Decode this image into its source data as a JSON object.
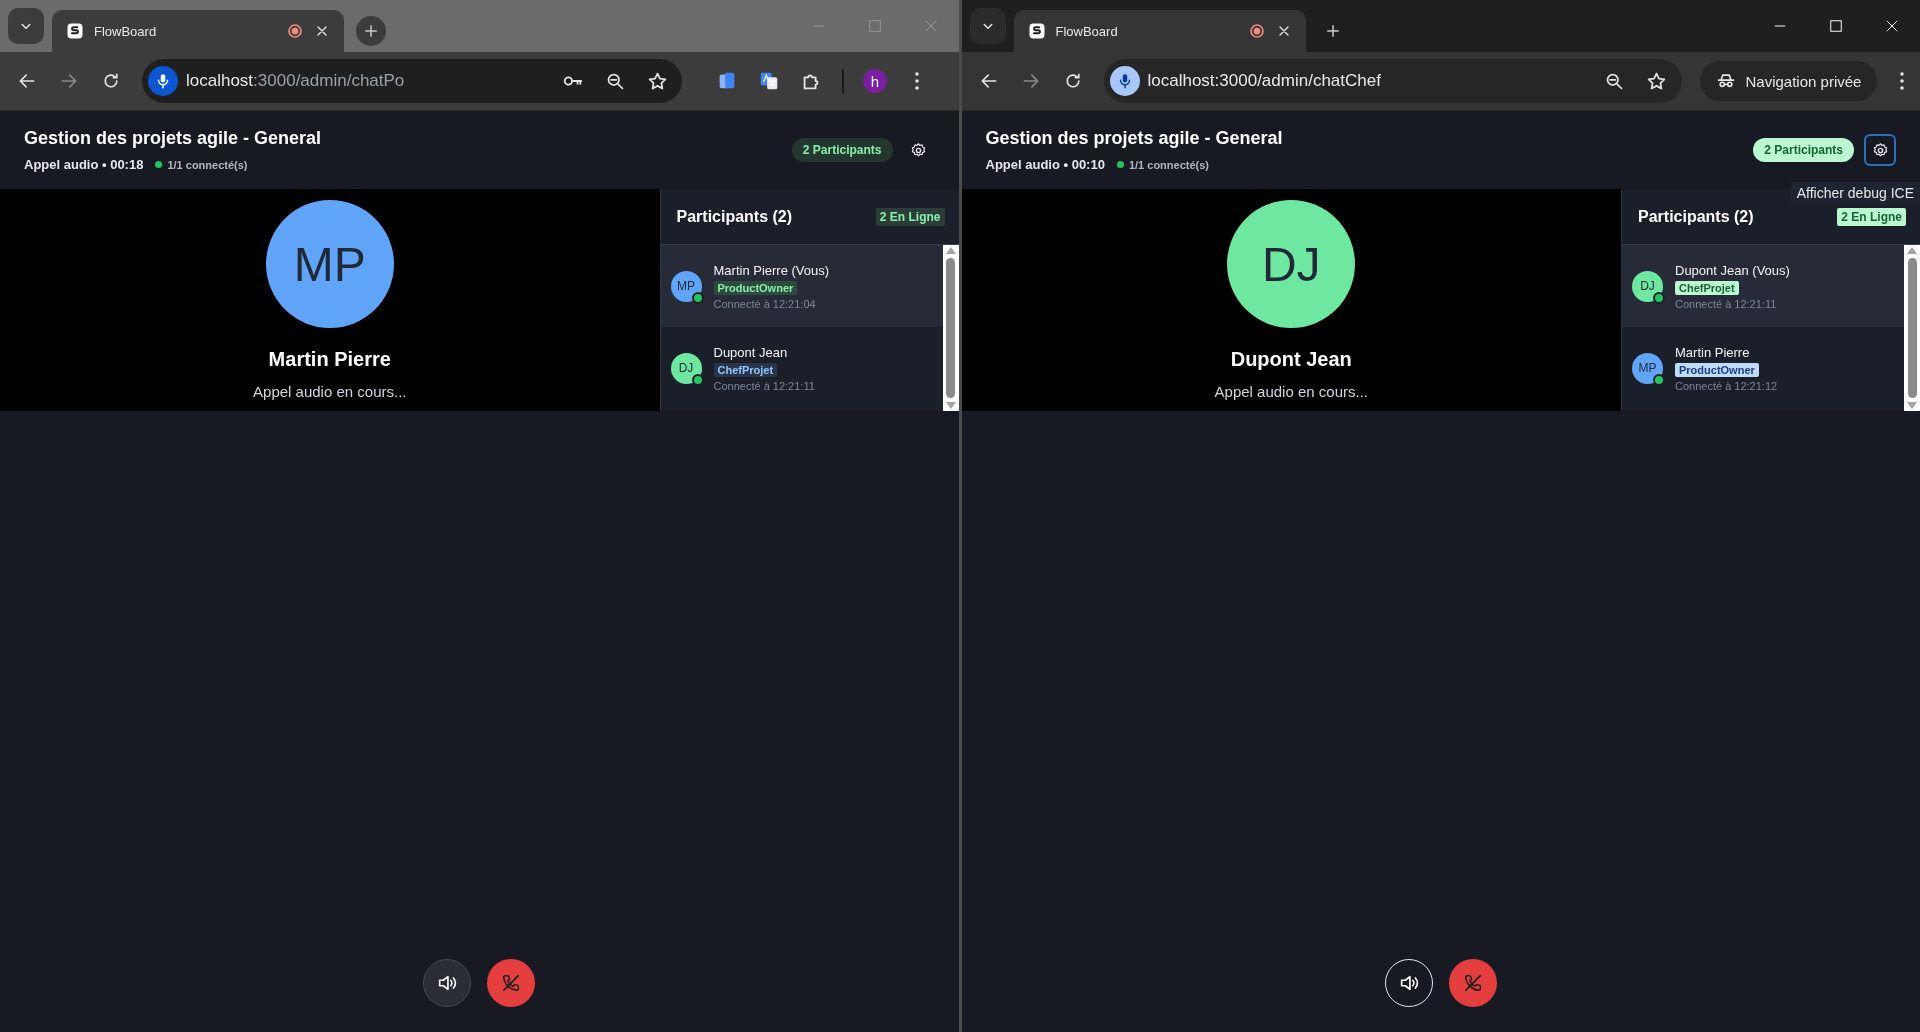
{
  "windows": [
    {
      "active": false,
      "incognito": false,
      "tab": {
        "title": "FlowBoard",
        "recording": true
      },
      "address": {
        "host": "localhost",
        "path": ":3000/admin/chatPo",
        "path_dimmed": true
      },
      "saved_password": true,
      "extensions": true,
      "profile": {
        "initial": "h"
      },
      "app": {
        "title": "Gestion des projets agile - General",
        "call_info": "Appel audio • 00:18",
        "connected": "1/1 connecté(s)",
        "participants_badge": "2 Participants",
        "light_badges": false,
        "settings_focused": false,
        "stage": {
          "initials": "MP",
          "color": "#60a5fa",
          "name": "Martin Pierre",
          "status": "Appel audio en cours..."
        },
        "panel": {
          "title": "Participants (2)",
          "online_badge": "2 En Ligne",
          "participants": [
            {
              "initials": "MP",
              "color": "#60a5fa",
              "name": "Martin Pierre (Vous)",
              "role": "ProductOwner",
              "connected_at": "Connecté à 12:21:04",
              "online": true,
              "selected": true
            },
            {
              "initials": "DJ",
              "color": "#6ee7a0",
              "name": "Dupont Jean",
              "role": "ChefProjet",
              "connected_at": "Connecté à 12:21:11",
              "online": true,
              "selected": false
            }
          ]
        },
        "speaker_outlined": false
      }
    },
    {
      "active": true,
      "incognito": true,
      "private_label": "Navigation privée",
      "tab": {
        "title": "FlowBoard",
        "recording": true
      },
      "address": {
        "host": "localhost",
        "path": ":3000/admin/chatChef",
        "path_dimmed": false
      },
      "saved_password": false,
      "extensions": false,
      "app": {
        "title": "Gestion des projets agile - General",
        "call_info": "Appel audio • 00:10",
        "connected": "1/1 connecté(s)",
        "participants_badge": "2 Participants",
        "light_badges": true,
        "settings_focused": true,
        "tooltip": "Afficher debug ICE",
        "stage": {
          "initials": "DJ",
          "color": "#6ee7a0",
          "name": "Dupont Jean",
          "status": "Appel audio en cours..."
        },
        "panel": {
          "title": "Participants (2)",
          "online_badge": "2 En Ligne",
          "participants": [
            {
              "initials": "DJ",
              "color": "#6ee7a0",
              "name": "Dupont Jean (Vous)",
              "role": "ChefProjet",
              "connected_at": "Connecté à 12:21:11",
              "online": true,
              "selected": true
            },
            {
              "initials": "MP",
              "color": "#60a5fa",
              "name": "Martin Pierre",
              "role": "ProductOwner",
              "connected_at": "Connecté à 12:21:12",
              "online": true,
              "selected": false
            }
          ]
        },
        "speaker_outlined": true
      }
    }
  ]
}
